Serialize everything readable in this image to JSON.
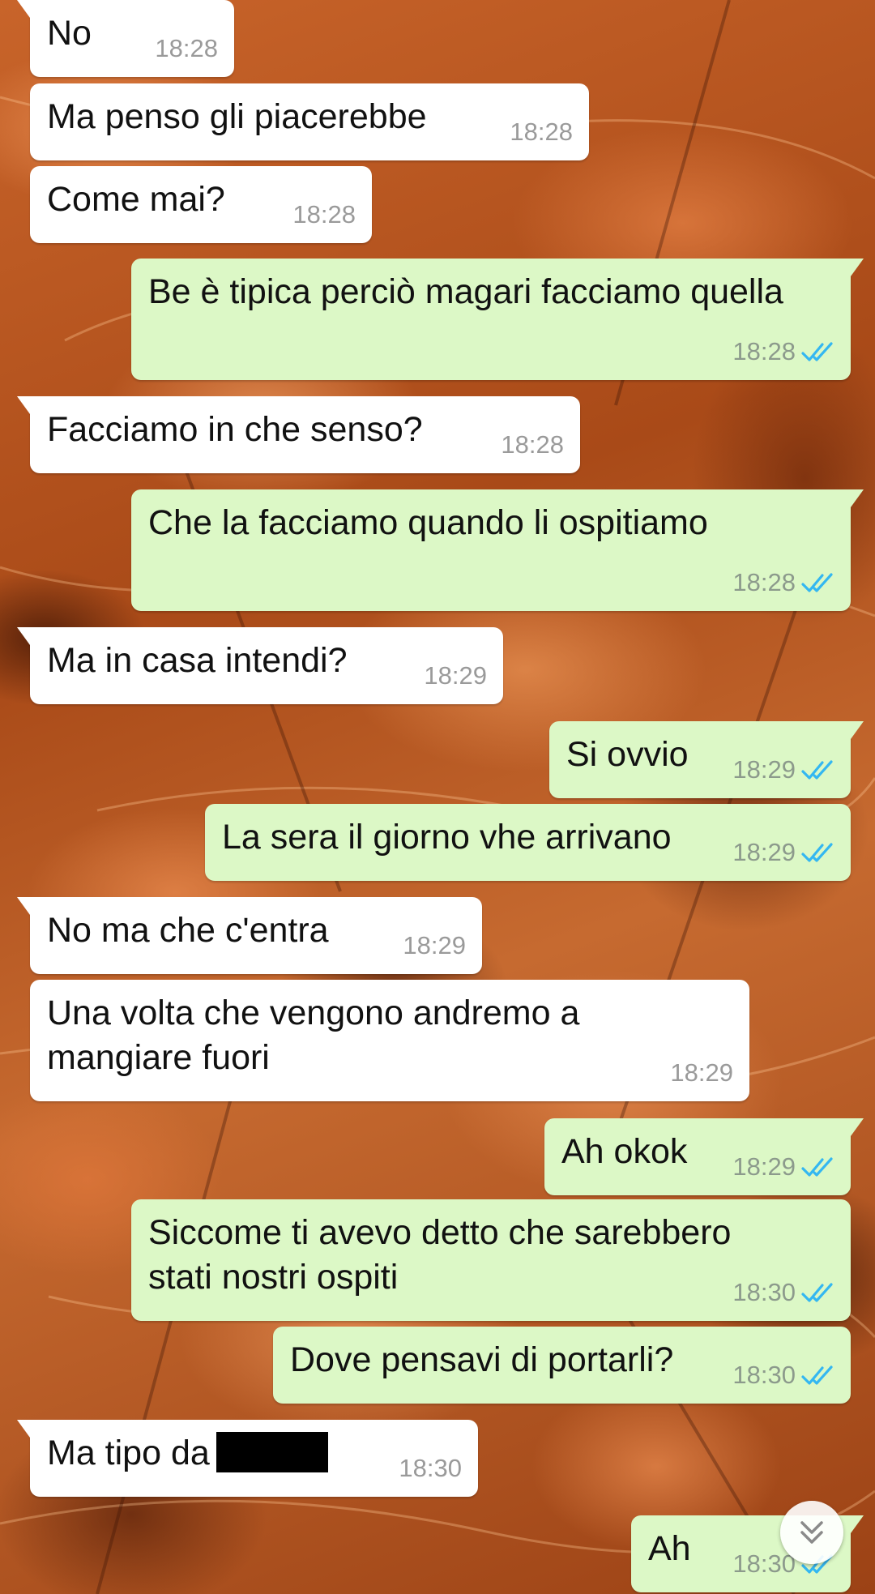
{
  "colors": {
    "incoming_bubble": "#ffffff",
    "outgoing_bubble": "#dcf8c6",
    "read_ticks": "#34b7f1",
    "time_text": "#9a9a9a"
  },
  "messages": [
    {
      "text": "No",
      "time": "18:28"
    },
    {
      "text": "Ma penso gli piacerebbe",
      "time": "18:28"
    },
    {
      "text": "Come mai?",
      "time": "18:28"
    },
    {
      "text": "Be è tipica perciò magari facciamo quella",
      "time": "18:28"
    },
    {
      "text": "Facciamo in che senso?",
      "time": "18:28"
    },
    {
      "text": "Che la facciamo quando li ospitiamo",
      "time": "18:28"
    },
    {
      "text": "Ma in casa intendi?",
      "time": "18:29"
    },
    {
      "text": "Si ovvio",
      "time": "18:29"
    },
    {
      "text": "La sera il giorno vhe arrivano",
      "time": "18:29"
    },
    {
      "text": "No ma che c'entra",
      "time": "18:29"
    },
    {
      "text_line1": "Una volta che vengono andremo a",
      "text_line2": "mangiare fuori",
      "time": "18:29"
    },
    {
      "text": "Ah okok",
      "time": "18:29"
    },
    {
      "text_line1": "Siccome ti avevo detto che sarebbero",
      "text_line2": "stati nostri ospiti",
      "time": "18:30"
    },
    {
      "text": "Dove pensavi di portarli?",
      "time": "18:30"
    },
    {
      "text": "Ma tipo da",
      "time": "18:30"
    },
    {
      "text": "Ah",
      "time": "18:30"
    }
  ],
  "icons": {
    "read_receipt": "double-check-icon",
    "scroll_down": "double-chevron-down-icon"
  }
}
